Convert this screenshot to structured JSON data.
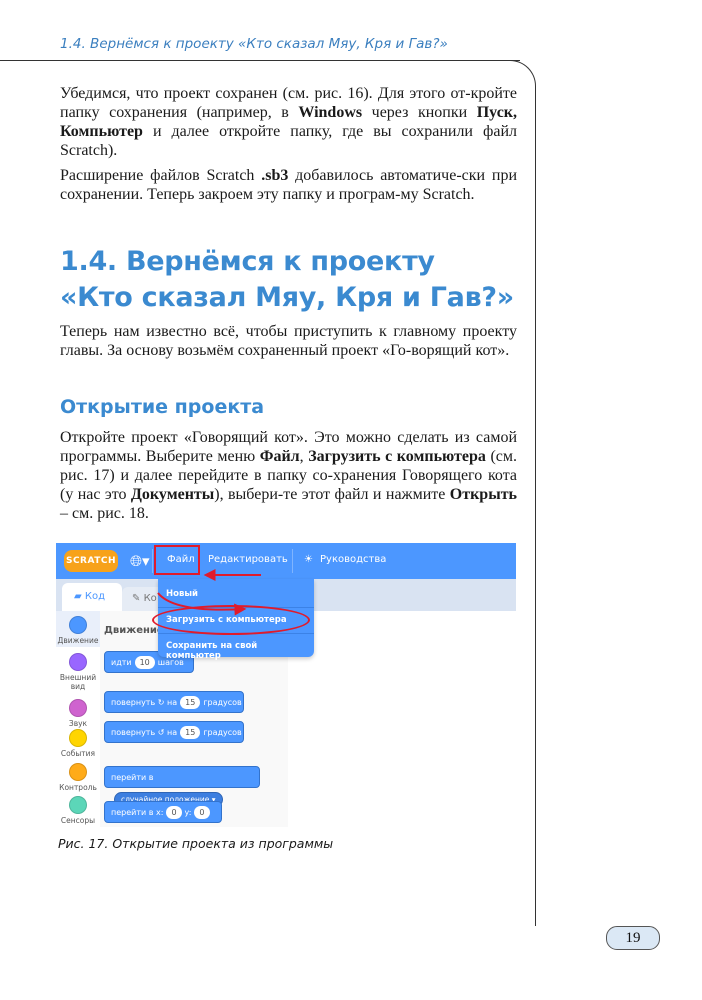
{
  "header": {
    "running_title": "1.4. Вернёмся к проекту «Кто сказал Мяу, Кря и Гав?»"
  },
  "intro": {
    "p1": [
      {
        "t": "Убедимся, что проект сохранен (см. рис. 16). Для этого от-кройте папку сохранения (например, в ",
        "b": false
      },
      {
        "t": "Windows",
        "b": true
      },
      {
        "t": " через кнопки ",
        "b": false
      },
      {
        "t": "Пуск, Компьютер",
        "b": true
      },
      {
        "t": " и далее откройте папку, где вы сохранили файл Scratch).",
        "b": false
      }
    ],
    "p2": [
      {
        "t": "Расширение файлов Scratch ",
        "b": false
      },
      {
        "t": ".sb3",
        "b": true
      },
      {
        "t": " добавилось автоматиче-ски при сохранении. Теперь закроем эту папку и програм-му Scratch.",
        "b": false
      }
    ]
  },
  "section": {
    "title_line1": "1.4. Вернёмся к проекту",
    "title_line2": "«Кто сказал Мяу, Кря и Гав?»",
    "p1": [
      {
        "t": "Теперь нам известно всё, чтобы приступить к главному проекту главы. За основу возьмём сохраненный проект «Го-ворящий кот».",
        "b": false
      }
    ]
  },
  "subsection": {
    "title": "Открытие проекта",
    "p1": [
      {
        "t": "Откройте проект «Говорящий кот». Это можно сделать из самой программы. Выберите меню ",
        "b": false
      },
      {
        "t": "Файл",
        "b": true
      },
      {
        "t": ", ",
        "b": false
      },
      {
        "t": "Загрузить с компьютера",
        "b": true
      },
      {
        "t": " (см. рис. 17) и далее перейдите в папку со-хранения Говорящего кота (у нас это ",
        "b": false
      },
      {
        "t": "Документы",
        "b": true
      },
      {
        "t": "), выбери-те этот файл и нажмите ",
        "b": false
      },
      {
        "t": "Открыть",
        "b": true
      },
      {
        "t": " – см. рис. 18.",
        "b": false
      }
    ]
  },
  "figure": {
    "logo": "SCRATCH",
    "menu": {
      "file": "Файл",
      "edit": "Редактировать",
      "tutorials": "Руководства"
    },
    "tabs": {
      "code": "Код",
      "costumes": "Ко"
    },
    "dropdown": [
      "Новый",
      "Загрузить с компьютера",
      "Сохранить на свой компьютер"
    ],
    "categories": [
      {
        "label": "Движение",
        "color": "#4c97ff"
      },
      {
        "label": "Внешний вид",
        "color": "#9966ff"
      },
      {
        "label": "Звук",
        "color": "#cf63cf"
      },
      {
        "label": "События",
        "color": "#ffd500"
      },
      {
        "label": "Контроль",
        "color": "#ffab19"
      },
      {
        "label": "Сенсоры",
        "color": "#5cd6b8"
      }
    ],
    "palette_heading": "Движение",
    "blocks": {
      "b1_pre": "идти",
      "b1_val": "10",
      "b1_post": "шагов",
      "b2_pre": "повернуть",
      "b2_on": "на",
      "b2_val": "15",
      "b2_post": "градусов",
      "b3_pre": "повернуть",
      "b3_on": "на",
      "b3_val": "15",
      "b3_post": "градусов",
      "b4_pre": "перейти в",
      "b4_val": "случайное положение",
      "b5_pre": "перейти в x:",
      "b5_x": "0",
      "b5_y_label": "y:",
      "b5_y": "0"
    },
    "caption": "Рис. 17. Открытие проекта из программы",
    "accent_red": "#e01b2c",
    "scratch_blue": "#4c97ff"
  },
  "footer": {
    "page_number": "19"
  }
}
